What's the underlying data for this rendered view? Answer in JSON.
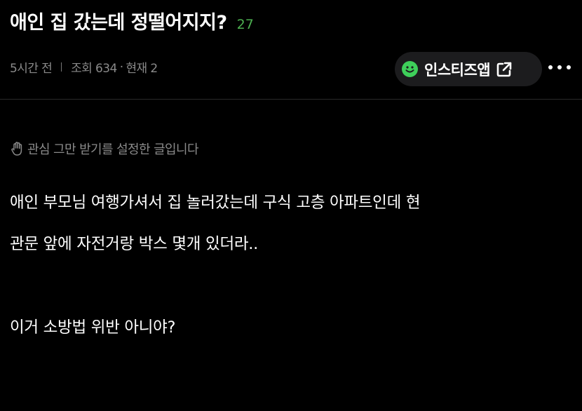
{
  "post": {
    "title": "애인 집 갔는데 정떨어지지?",
    "comment_count": "27",
    "time": "5시간 전",
    "views": "조회 634",
    "current": "현재 2",
    "meta_dot": "·"
  },
  "app_button": {
    "label": "인스티즈앱",
    "icon_left": "smile-icon",
    "icon_right": "external-link-icon"
  },
  "more_menu": {
    "icon": "more-dots-icon"
  },
  "notice": {
    "icon": "hand-stop-icon",
    "text": "관심 그만 받기를 설정한 글입니다"
  },
  "body": {
    "lines": [
      "애인 부모님 여행가셔서 집 놀러갔는데 구식 고층 아파트인데 현",
      "관문 앞에 자전거랑 박스 몇개 있더라..",
      "이거 소방법 위반 아니야?"
    ]
  },
  "colors": {
    "background": "#000000",
    "comment_count": "#4caf50",
    "smile_icon": "#3ecf5a",
    "meta_text": "#8a8a8a",
    "pill_background": "#1c1c1e"
  }
}
